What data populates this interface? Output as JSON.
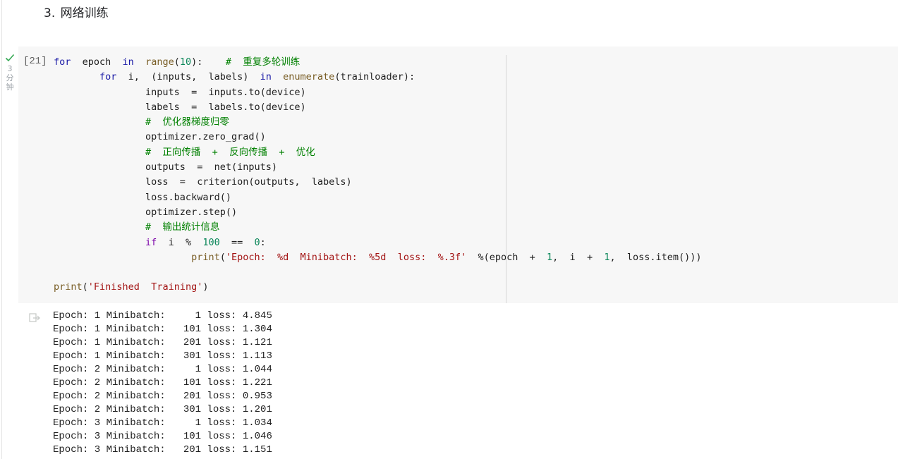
{
  "heading": {
    "number": "3.",
    "title": "网络训练"
  },
  "cell": {
    "execution_count": "[21]",
    "status_icon": "check-icon",
    "exec_time_chars": [
      "3",
      "分",
      "钟"
    ],
    "code_lines": [
      [
        {
          "t": "kw",
          "v": "for"
        },
        {
          "t": "op",
          "v": "  epoch  "
        },
        {
          "t": "kw",
          "v": "in"
        },
        {
          "t": "op",
          "v": "  "
        },
        {
          "t": "fn",
          "v": "range"
        },
        {
          "t": "op",
          "v": "("
        },
        {
          "t": "num-lit",
          "v": "10"
        },
        {
          "t": "op",
          "v": "):    "
        },
        {
          "t": "cmt",
          "v": "#  重复多轮训练"
        }
      ],
      [
        {
          "t": "op",
          "v": "        "
        },
        {
          "t": "kw",
          "v": "for"
        },
        {
          "t": "op",
          "v": "  i,  (inputs,  labels)  "
        },
        {
          "t": "kw",
          "v": "in"
        },
        {
          "t": "op",
          "v": "  "
        },
        {
          "t": "fn",
          "v": "enumerate"
        },
        {
          "t": "op",
          "v": "(trainloader):"
        }
      ],
      [
        {
          "t": "op",
          "v": "                inputs  =  inputs.to(device)"
        }
      ],
      [
        {
          "t": "op",
          "v": "                labels  =  labels.to(device)"
        }
      ],
      [
        {
          "t": "op",
          "v": "                "
        },
        {
          "t": "cmt",
          "v": "#  优化器梯度归零"
        }
      ],
      [
        {
          "t": "op",
          "v": "                optimizer.zero_grad()"
        }
      ],
      [
        {
          "t": "op",
          "v": "                "
        },
        {
          "t": "cmt",
          "v": "#  正向传播  +  反向传播  +  优化"
        }
      ],
      [
        {
          "t": "op",
          "v": "                outputs  =  net(inputs)"
        }
      ],
      [
        {
          "t": "op",
          "v": "                loss  =  criterion(outputs,  labels)"
        }
      ],
      [
        {
          "t": "op",
          "v": "                loss.backward()"
        }
      ],
      [
        {
          "t": "op",
          "v": "                optimizer.step()"
        }
      ],
      [
        {
          "t": "op",
          "v": "                "
        },
        {
          "t": "cmt",
          "v": "#  输出统计信息"
        }
      ],
      [
        {
          "t": "op",
          "v": "                "
        },
        {
          "t": "kw2",
          "v": "if"
        },
        {
          "t": "op",
          "v": "  i  %  "
        },
        {
          "t": "num-lit",
          "v": "100"
        },
        {
          "t": "op",
          "v": "  ==  "
        },
        {
          "t": "num-lit",
          "v": "0"
        },
        {
          "t": "op",
          "v": ":"
        }
      ],
      [
        {
          "t": "op",
          "v": "                        "
        },
        {
          "t": "fn",
          "v": "print"
        },
        {
          "t": "op",
          "v": "("
        },
        {
          "t": "str",
          "v": "'Epoch:  %d  Minibatch:  %5d  loss:  %.3f'"
        },
        {
          "t": "op",
          "v": "  %(epoch  +  "
        },
        {
          "t": "num-lit",
          "v": "1"
        },
        {
          "t": "op",
          "v": ",  i  +  "
        },
        {
          "t": "num-lit",
          "v": "1"
        },
        {
          "t": "op",
          "v": ",  loss.item()))"
        }
      ],
      [
        {
          "t": "op",
          "v": ""
        }
      ],
      [
        {
          "t": "fn",
          "v": "print"
        },
        {
          "t": "op",
          "v": "("
        },
        {
          "t": "str",
          "v": "'Finished  Training'"
        },
        {
          "t": "op",
          "v": ")"
        }
      ]
    ]
  },
  "output": {
    "icon": "output-redirect-icon",
    "lines": [
      "Epoch: 1 Minibatch:     1 loss: 4.845",
      "Epoch: 1 Minibatch:   101 loss: 1.304",
      "Epoch: 1 Minibatch:   201 loss: 1.121",
      "Epoch: 1 Minibatch:   301 loss: 1.113",
      "Epoch: 2 Minibatch:     1 loss: 1.044",
      "Epoch: 2 Minibatch:   101 loss: 1.221",
      "Epoch: 2 Minibatch:   201 loss: 0.953",
      "Epoch: 2 Minibatch:   301 loss: 1.201",
      "Epoch: 3 Minibatch:     1 loss: 1.034",
      "Epoch: 3 Minibatch:   101 loss: 1.046",
      "Epoch: 3 Minibatch:   201 loss: 1.151"
    ]
  },
  "colors": {
    "keyword": "#1a1aa6",
    "function": "#795e26",
    "string": "#a31515",
    "number": "#098658",
    "comment": "#008000",
    "cell_background": "#f7f7f7",
    "success": "#34a853"
  }
}
